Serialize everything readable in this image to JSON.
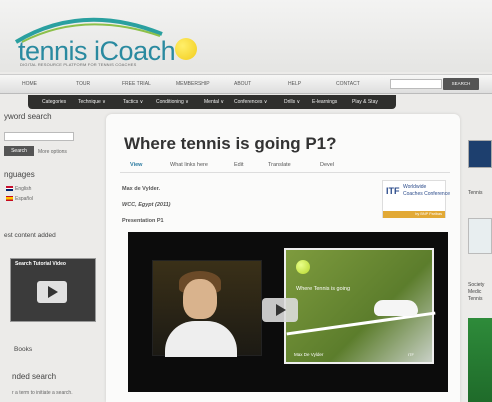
{
  "logo": {
    "title": "tennis iCoach",
    "subtitle": "DIGITAL RESOURCE PLATFORM FOR TENNIS COACHES"
  },
  "topnav": {
    "items": [
      "HOME",
      "TOUR",
      "FREE TRIAL",
      "MEMBERSHIP",
      "ABOUT",
      "HELP",
      "CONTACT"
    ],
    "search_button": "SEARCH"
  },
  "subnav": {
    "items": [
      "Categories",
      "Technique ∨",
      "Tactics ∨",
      "Conditioning ∨",
      "Mental ∨",
      "Conferences ∨",
      "Drills ∨",
      "E-learnings",
      "Play & Stay"
    ]
  },
  "sidebar_left": {
    "keyword_title": "yword search",
    "search_button": "Search",
    "more_options": "More options",
    "languages_title": "nguages",
    "languages": [
      "English",
      "Español"
    ],
    "latest_title": "est content added",
    "video_title": "Search Tutorial Video",
    "books_title": "Books",
    "advanced_title": "nded search",
    "advanced_hint": "r a term to initiate a search."
  },
  "content": {
    "title": "Where tennis is going P1?",
    "tabs": [
      "View",
      "What links here",
      "Edit",
      "Translate",
      "Devel"
    ],
    "author": "Max de Vylder.",
    "event": "WCC, Egypt (2011)",
    "presentation": "Presentation P1"
  },
  "itf_badge": {
    "logo": "ITF",
    "line1": "Worldwide",
    "line2": "Coaches Conference",
    "sponsor": "by BNP Paribas"
  },
  "video": {
    "slide_title": "Where Tennis is going",
    "presenter": "Max De Vylder"
  },
  "sidebar_right": {
    "label1": "Tennis",
    "label2": "Society Medic Tennis"
  },
  "colors": {
    "brand": "#2a8aa0",
    "subnav_bg": "#2f2f2d",
    "badge_gold": "#e2a935"
  }
}
